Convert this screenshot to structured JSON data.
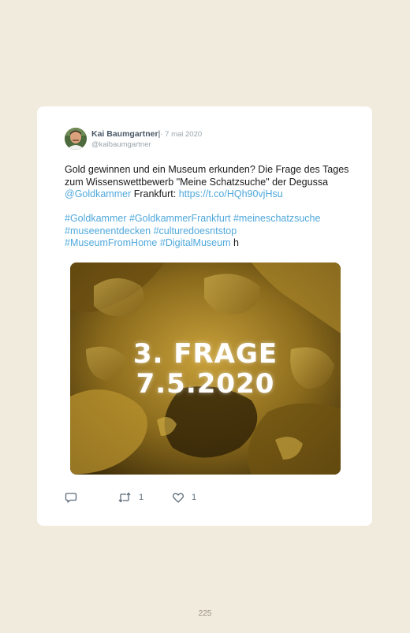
{
  "tweet": {
    "user_name": "Kai Baumgartner",
    "separator": "|",
    "date": "· 7 mai 2020",
    "handle": "@kaibaumgartner",
    "text": {
      "line1_intro": "Gold gewinnen und ein Museum erkunden? Die Frage des Tages zum Wissenswettbewerb \"Meine Schatzsuche\" der Degussa ",
      "mention": "@Goldkammer",
      "line1_middle": " Frankfurt: ",
      "url": "https://t.co/HQh90vjHsu",
      "hashtags_1": "#Goldkammer #GoldkammerFrankfurt #meineschatzsuche",
      "hashtags_2": "#museenentdecken #culturedoesntstop",
      "hashtags_3": "#MuseumFromHome #DigitalMuseum",
      "trailing": " h"
    },
    "media": {
      "line1": "3. FRAGE",
      "line2": "7.5.2020"
    },
    "actions": {
      "reply_icon": "reply-icon",
      "retweet_icon": "retweet-icon",
      "retweet_count": "1",
      "like_icon": "heart-icon",
      "like_count": "1"
    }
  },
  "colors": {
    "page_background": "#f1ebdd",
    "card_background": "#ffffff",
    "link": "#4fa8dc",
    "muted": "#9aa5ad",
    "name": "#4a5866"
  },
  "page": {
    "number": "225"
  }
}
